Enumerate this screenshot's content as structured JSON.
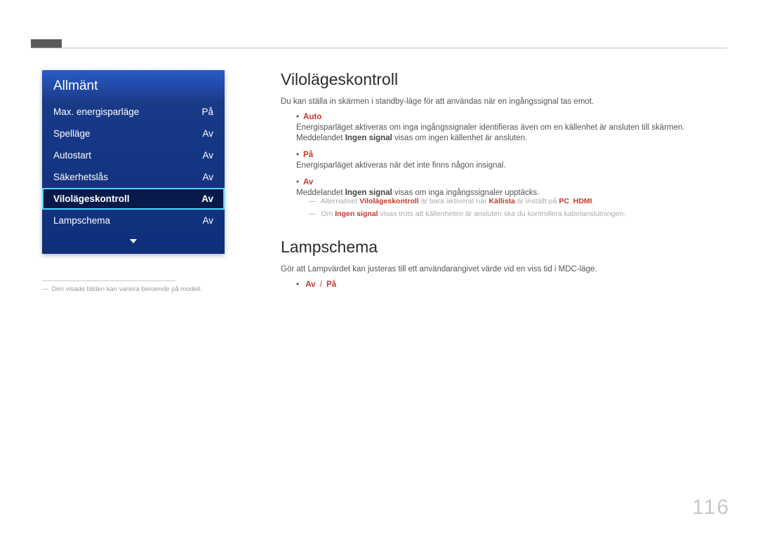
{
  "menu": {
    "title": "Allmänt",
    "items": [
      {
        "label": "Max. energisparläge",
        "value": "På",
        "selected": false
      },
      {
        "label": "Spelläge",
        "value": "Av",
        "selected": false
      },
      {
        "label": "Autostart",
        "value": "Av",
        "selected": false
      },
      {
        "label": "Säkerhetslås",
        "value": "Av",
        "selected": false
      },
      {
        "label": "Vilolägeskontroll",
        "value": "Av",
        "selected": true
      },
      {
        "label": "Lampschema",
        "value": "Av",
        "selected": false
      }
    ],
    "footnote": "Den visade bilden kan variera beroende på modell."
  },
  "section1": {
    "heading": "Vilolägeskontroll",
    "intro": "Du kan ställa in skärmen i standby-läge för att användas när en ingångssignal tas emot.",
    "bullets": {
      "auto": {
        "key": "Auto",
        "line1a": "Energisparläget aktiveras om inga ingångssignaler identifieras även om en källenhet är ansluten till skärmen.",
        "line2a": "Meddelandet ",
        "line2b": "Ingen signal",
        "line2c": " visas om ingen källenhet är ansluten."
      },
      "pa": {
        "key": "På",
        "line": "Energisparläget aktiveras när det inte finns någon insignal."
      },
      "av": {
        "key": "Av",
        "line1a": "Meddelandet ",
        "line1b": "Ingen signal",
        "line1c": " visas om inga ingångssignaler upptäcks."
      }
    },
    "notes": {
      "n1a": "Alternativet ",
      "n1b": "Vilolägeskontroll",
      "n1c": " är bara aktiverat när ",
      "n1d": "Källista",
      "n1e": " är inställt på ",
      "n1f": "PC",
      "n1g": ", ",
      "n1h": "HDMI",
      "n1i": ".",
      "n2a": "Om ",
      "n2b": "Ingen signal",
      "n2c": " visas trots att källenheten är ansluten ska du kontrollera kabelanslutningen."
    }
  },
  "section2": {
    "heading": "Lampschema",
    "intro": "Gör att Lampvärdet kan justeras till ett användarangivet värde vid en viss tid i MDC-läge.",
    "opt_av": "Av",
    "opt_sep": "/",
    "opt_pa": "På"
  },
  "page_number": "116"
}
